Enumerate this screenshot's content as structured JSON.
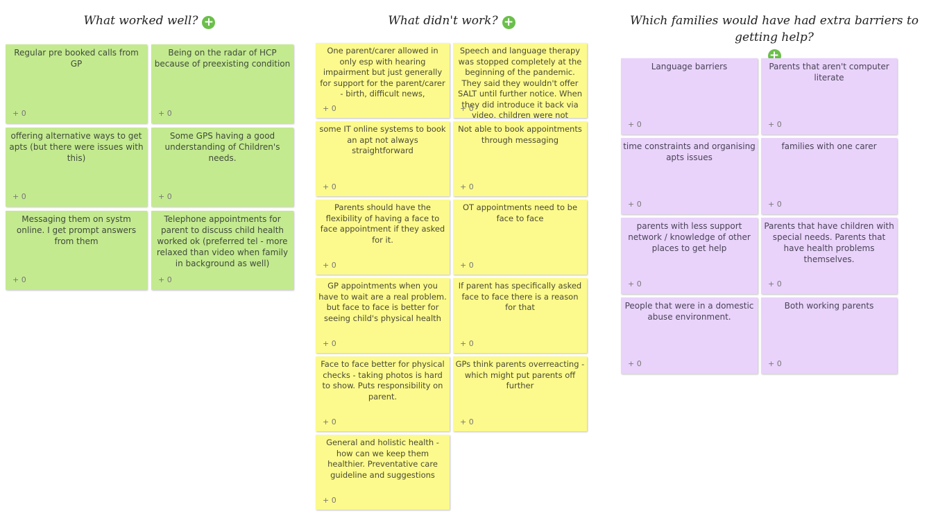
{
  "columns": [
    {
      "title": "What worked well?",
      "color": "#c4ea90",
      "notes": [
        {
          "text": "Regular pre booked calls from GP",
          "votes": "+ 0"
        },
        {
          "text": "Being on the radar of HCP because of preexisting condition",
          "votes": "+ 0"
        },
        {
          "text": "offering alternative ways to get apts (but there were issues with this)",
          "votes": "+ 0"
        },
        {
          "text": "Some GPS having a good understanding of Children's needs.",
          "votes": "+ 0"
        },
        {
          "text": "Messaging them on systm online. I get prompt answers from them",
          "votes": "+ 0"
        },
        {
          "text": "Telephone appointments for parent to discuss child health worked ok (preferred tel - more relaxed than video when family in background as well)",
          "votes": "+ 0"
        }
      ]
    },
    {
      "title": "What didn't work?",
      "color": "#fcfa8c",
      "notes": [
        {
          "text": "One parent/carer allowed in only esp with hearing impairment but just generally for support for the parent/carer - birth, difficult news,",
          "votes": "+ 0"
        },
        {
          "text": "Speech and language therapy was stopped completely at the beginning of the pandemic. They said they wouldn't offer SALT until further notice. When they did introduce it back via video, children were not",
          "votes": "+ 0"
        },
        {
          "text": "some IT online systems to book an apt not always straightforward",
          "votes": "+ 0"
        },
        {
          "text": "Not able to book appointments through messaging",
          "votes": "+ 0"
        },
        {
          "text": "Parents should have the flexibility of having a face to face appointment if they asked for it.",
          "votes": "+ 0"
        },
        {
          "text": "OT appointments need to be face to face",
          "votes": "+ 0"
        },
        {
          "text": "GP appointments when you have to wait are a real problem. but face to face is better for seeing child's physical health",
          "votes": "+ 0"
        },
        {
          "text": "If parent has specifically asked face to face there is a reason for that",
          "votes": "+ 0"
        },
        {
          "text": "Face to face better for physical checks - taking photos is hard to show. Puts responsibility on parent.",
          "votes": "+ 0"
        },
        {
          "text": "GPs think parents overreacting - which might put parents off further",
          "votes": "+ 0"
        },
        {
          "text": "General and holistic health - how can we keep them healthier. Preventative care guideline and suggestions",
          "votes": "+ 0"
        }
      ]
    },
    {
      "title": "Which families would have had extra barriers to getting help?",
      "color": "#e9d3fa",
      "notes": [
        {
          "text": "Language barriers",
          "votes": "+ 0"
        },
        {
          "text": "Parents that aren't computer literate",
          "votes": "+ 0"
        },
        {
          "text": "time constraints and organising apts issues",
          "votes": "+ 0"
        },
        {
          "text": "families with one carer",
          "votes": "+ 0"
        },
        {
          "text": "parents with less support network / knowledge of other places to get help",
          "votes": "+ 0"
        },
        {
          "text": "Parents that have children with special needs. Parents that have health problems themselves.",
          "votes": "+ 0"
        },
        {
          "text": "People that were in a domestic abuse environment.",
          "votes": "+ 0"
        },
        {
          "text": "Both working parents",
          "votes": "+ 0"
        }
      ]
    }
  ]
}
